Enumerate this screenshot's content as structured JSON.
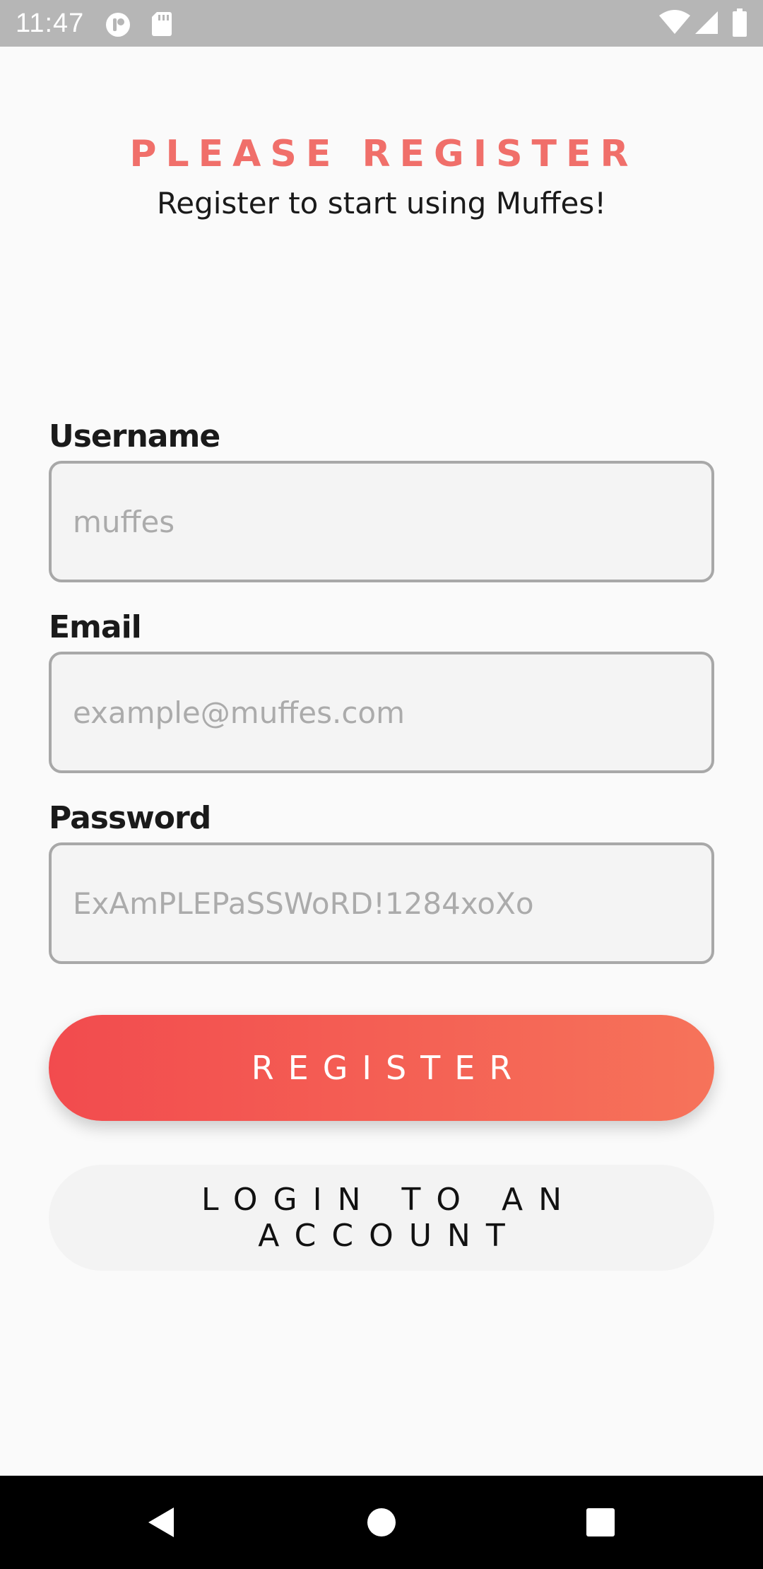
{
  "status_bar": {
    "time": "11:47",
    "left_icons": [
      "app-notification-icon",
      "sd-card-icon"
    ],
    "right_icons": [
      "wifi-icon",
      "cell-signal-icon",
      "battery-icon"
    ]
  },
  "header": {
    "title": "PLEASE REGISTER",
    "subtitle": "Register to start using Muffes!"
  },
  "form": {
    "username": {
      "label": "Username",
      "placeholder": "muffes"
    },
    "email": {
      "label": "Email",
      "placeholder": "example@muffes.com"
    },
    "password": {
      "label": "Password",
      "placeholder": "ExAmPLEPaSSWoRD!1284xoXo"
    }
  },
  "actions": {
    "register_label": "REGISTER",
    "login_label": "LOGIN TO AN ACCOUNT"
  },
  "colors": {
    "accent": "#f06f6a",
    "gradient_start": "#f24b4e",
    "gradient_end": "#f6735a",
    "status_bar": "#b6b6b6",
    "background": "#fafafa"
  },
  "nav_bar": {
    "icons": [
      "back-icon",
      "home-icon",
      "recents-icon"
    ]
  }
}
